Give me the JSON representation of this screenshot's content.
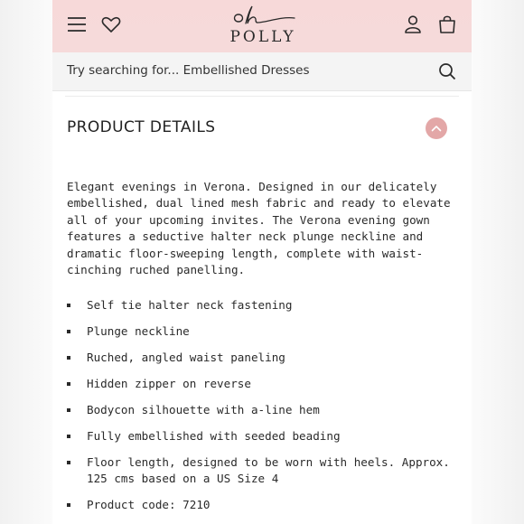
{
  "brand": {
    "script": "oh",
    "name": "POLLY"
  },
  "search": {
    "placeholder": "Try searching for...  Embellished Dresses"
  },
  "details": {
    "title": "PRODUCT DETAILS",
    "expanded": true,
    "description": "Elegant evenings in Verona. Designed in our delicately embellished, dual lined mesh fabric and ready to elevate all of your upcoming invites. The Verona evening gown features a seductive halter neck plunge neckline and dramatic floor-sweeping length, complete with waist-cinching ruched panelling.",
    "features": [
      "Self tie halter neck fastening",
      "Plunge neckline",
      "Ruched, angled waist paneling",
      "Hidden zipper on reverse",
      "Bodycon silhouette with a-line hem",
      "Fully embellished with seeded beading",
      "Floor length, designed to be worn with heels. Approx. 125 cms based on a US Size 4",
      "Product code: 7210"
    ]
  },
  "icons": {
    "menu": "hamburger-menu-icon",
    "wishlist": "heart-icon",
    "account": "user-icon",
    "bag": "shopping-bag-icon",
    "search": "search-icon",
    "collapse": "chevron-up-icon"
  },
  "colors": {
    "header_bg": "#f7d9d9",
    "accent": "#e3a7a7",
    "text": "#2a2a2a"
  }
}
